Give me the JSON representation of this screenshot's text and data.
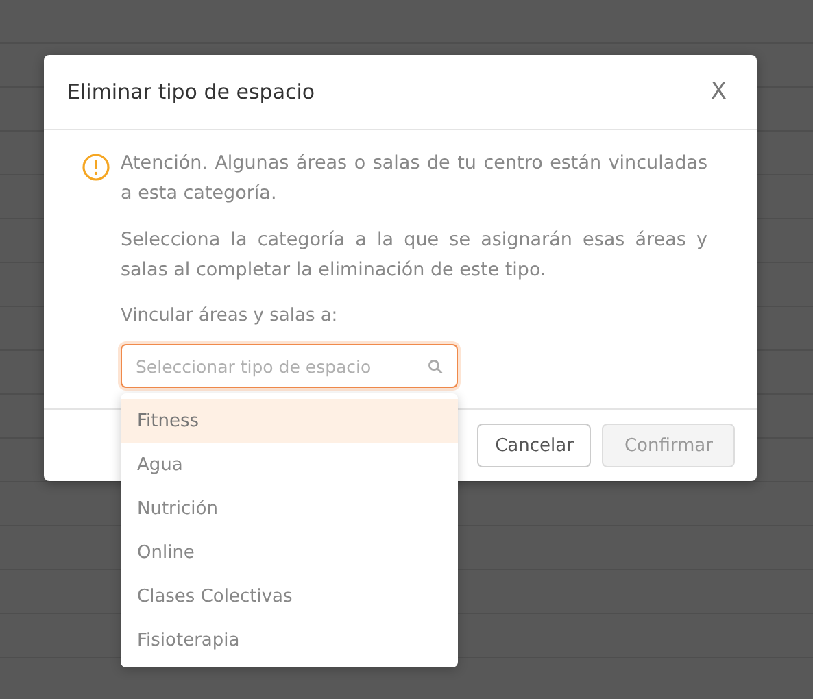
{
  "dialog": {
    "title": "Eliminar tipo de espacio",
    "close": "X",
    "warning": "Atención. Algunas áreas o salas de tu centro están vinculadas a esta categoría.",
    "instruction": "Selecciona la categoría a la que se asignarán esas áreas y salas al completar la eliminación de este tipo.",
    "field_label": "Vincular áreas y salas a:",
    "search": {
      "placeholder": "Seleccionar tipo de espacio"
    },
    "options": [
      {
        "label": "Fitness",
        "selected": true
      },
      {
        "label": "Agua",
        "selected": false
      },
      {
        "label": "Nutrición",
        "selected": false
      },
      {
        "label": "Online",
        "selected": false
      },
      {
        "label": "Clases Colectivas",
        "selected": false
      },
      {
        "label": "Fisioterapia",
        "selected": false
      }
    ],
    "buttons": [
      {
        "label": "Cancelar",
        "disabled": false
      },
      {
        "label": "Confirmar",
        "disabled": true
      }
    ]
  }
}
